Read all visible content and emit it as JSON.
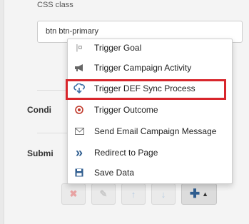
{
  "form": {
    "css_class_label": "CSS class",
    "css_class_value": "btn btn-primary",
    "conditions_label": "Condi",
    "submit_label": "Submi"
  },
  "menu": {
    "items": [
      {
        "label": "Trigger Goal",
        "icon": "goal-flag-icon",
        "glyph": "|¤",
        "color": "#888888"
      },
      {
        "label": "Trigger Campaign Activity",
        "icon": "megaphone-icon",
        "glyph": "📢",
        "color": "#666666"
      },
      {
        "label": "Trigger DEF Sync Process",
        "icon": "cloud-sync-icon",
        "glyph": "☁",
        "color": "#3a6ea5"
      },
      {
        "label": "Trigger Outcome",
        "icon": "target-icon",
        "glyph": "◎",
        "color": "#c0392b"
      },
      {
        "label": "Send Email Campaign Message",
        "icon": "envelope-icon",
        "glyph": "✉",
        "color": "#777777"
      },
      {
        "label": "Redirect to Page",
        "icon": "double-chevron-right-icon",
        "glyph": "»",
        "color": "#2f5d8f"
      },
      {
        "label": "Save Data",
        "icon": "floppy-disk-icon",
        "glyph": "▣",
        "color": "#2f5d8f"
      }
    ],
    "highlighted_index": 2,
    "highlight_color": "#d8262c"
  },
  "toolbar": {
    "delete_glyph": "✖",
    "edit_glyph": "✎",
    "up_glyph": "↑",
    "down_glyph": "↓",
    "add_plus_glyph": "✚",
    "add_caret_glyph": "▲"
  }
}
